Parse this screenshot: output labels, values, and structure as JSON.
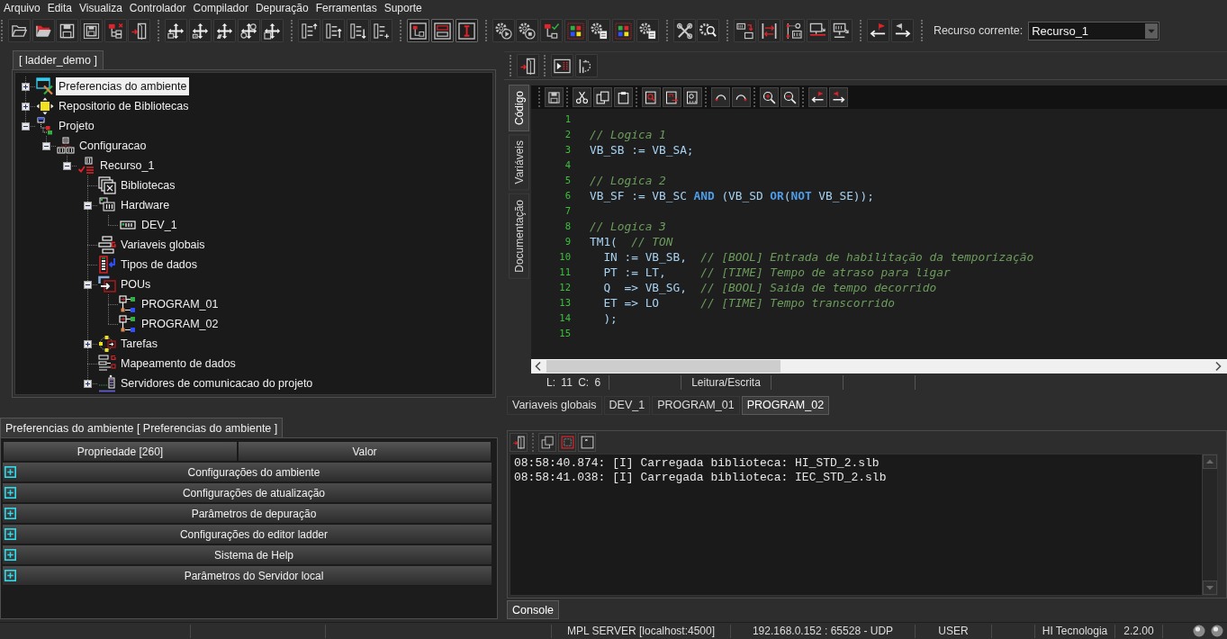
{
  "menu_bar": {
    "items": [
      "Arquivo",
      "Edita",
      "Visualiza",
      "Controlador",
      "Compilador",
      "Depuração",
      "Ferramentas",
      "Suporte"
    ]
  },
  "toolbar": {
    "resource_label": "Recurso corrente:",
    "resource_value": "Recurso_1"
  },
  "project_panel": {
    "tab": "[ ladder_demo ]",
    "tree": [
      {
        "label": "Preferencias do ambiente",
        "kind": "preferences",
        "selected": true,
        "expanded": false
      },
      {
        "label": "Repositorio de Bibliotecas",
        "kind": "library-repository",
        "selected": false,
        "expanded": false
      },
      {
        "label": "Projeto",
        "kind": "project",
        "selected": false,
        "expanded": true,
        "children": [
          {
            "label": "Configuracao",
            "kind": "configuration",
            "selected": false,
            "expanded": true,
            "children": [
              {
                "label": "Recurso_1",
                "kind": "resource",
                "selected": false,
                "expanded": true,
                "children": [
                  {
                    "label": "Bibliotecas",
                    "kind": "libraries",
                    "selected": false
                  },
                  {
                    "label": "Hardware",
                    "kind": "hardware",
                    "selected": false,
                    "expanded": true,
                    "children": [
                      {
                        "label": "DEV_1",
                        "kind": "device",
                        "selected": false
                      }
                    ]
                  },
                  {
                    "label": "Variaveis globais",
                    "kind": "global-variables",
                    "selected": false
                  },
                  {
                    "label": "Tipos de dados",
                    "kind": "data-types",
                    "selected": false
                  },
                  {
                    "label": "POUs",
                    "kind": "pous",
                    "selected": false,
                    "expanded": true,
                    "children": [
                      {
                        "label": "PROGRAM_01",
                        "kind": "program",
                        "selected": false
                      },
                      {
                        "label": "PROGRAM_02",
                        "kind": "program",
                        "selected": false
                      }
                    ]
                  },
                  {
                    "label": "Tarefas",
                    "kind": "tasks",
                    "selected": false,
                    "expanded": false
                  },
                  {
                    "label": "Mapeamento de dados",
                    "kind": "data-mapping",
                    "selected": false
                  },
                  {
                    "label": "Servidores de comunicacao do projeto",
                    "kind": "servers",
                    "selected": false,
                    "expanded": false
                  }
                ]
              }
            ]
          }
        ]
      }
    ]
  },
  "properties_panel": {
    "tab": "Preferencias do ambiente [ Preferencias do ambiente ]",
    "columns": [
      "Propriedade [260]",
      "Valor"
    ],
    "groups": [
      {
        "label": "Configurações do ambiente",
        "expanded": false
      },
      {
        "label": "Configurações de atualização",
        "expanded": false
      },
      {
        "label": "Parâmetros de depuração",
        "expanded": false
      },
      {
        "label": "Configurações do editor ladder",
        "expanded": false
      },
      {
        "label": "Sistema de Help",
        "expanded": false
      },
      {
        "label": "Parâmetros do Servidor local",
        "expanded": false
      }
    ]
  },
  "editor": {
    "side_tabs": [
      {
        "label": "Código",
        "selected": true
      },
      {
        "label": "Variáveis",
        "selected": false
      },
      {
        "label": "Documentação",
        "selected": false
      }
    ],
    "lines": [
      {
        "number": "1"
      },
      {
        "number": "2",
        "tokens": [
          {
            "kind": "comment",
            "text": "// Logica 1"
          }
        ]
      },
      {
        "number": "3",
        "tokens": [
          {
            "kind": "code",
            "text": "VB_SB := VB_SA;"
          }
        ]
      },
      {
        "number": "4"
      },
      {
        "number": "5",
        "tokens": [
          {
            "kind": "comment",
            "text": "// Logica 2"
          }
        ]
      },
      {
        "number": "6",
        "tokens": [
          {
            "kind": "code",
            "text": "VB_SF := VB_SC "
          },
          {
            "kind": "keyword",
            "text": "AND"
          },
          {
            "kind": "code",
            "text": " (VB_SD "
          },
          {
            "kind": "keyword",
            "text": "OR"
          },
          {
            "kind": "code",
            "text": "("
          },
          {
            "kind": "keyword",
            "text": "NOT"
          },
          {
            "kind": "code",
            "text": " VB_SE));"
          }
        ]
      },
      {
        "number": "7"
      },
      {
        "number": "8",
        "tokens": [
          {
            "kind": "comment",
            "text": "// Logica 3"
          }
        ]
      },
      {
        "number": "9",
        "tokens": [
          {
            "kind": "code",
            "text": "TM1(  "
          },
          {
            "kind": "comment",
            "text": "// TON"
          }
        ]
      },
      {
        "number": "10",
        "tokens": [
          {
            "kind": "code",
            "text": "  IN := VB_SB,  "
          },
          {
            "kind": "comment",
            "text": "// [BOOL] Entrada de habilitação da temporização"
          }
        ]
      },
      {
        "number": "11",
        "tokens": [
          {
            "kind": "code",
            "text": "  PT := LT,     "
          },
          {
            "kind": "comment",
            "text": "// [TIME] Tempo de atraso para ligar"
          }
        ]
      },
      {
        "number": "12",
        "tokens": [
          {
            "kind": "code",
            "text": "  Q  => VB_SG,  "
          },
          {
            "kind": "comment",
            "text": "// [BOOL] Saida de tempo decorrido"
          }
        ]
      },
      {
        "number": "13",
        "tokens": [
          {
            "kind": "code",
            "text": "  ET => LO      "
          },
          {
            "kind": "comment",
            "text": "// [TIME] Tempo transcorrido"
          }
        ]
      },
      {
        "number": "14",
        "tokens": [
          {
            "kind": "code",
            "text": "  );"
          }
        ]
      },
      {
        "number": "15"
      }
    ],
    "status": {
      "position": "L: 11 C: 6",
      "mode": "Leitura/Escrita"
    }
  },
  "document_tabs": [
    {
      "label": "Variaveis globais",
      "selected": false
    },
    {
      "label": "DEV_1",
      "selected": false
    },
    {
      "label": "PROGRAM_01",
      "selected": false
    },
    {
      "label": "PROGRAM_02",
      "selected": true
    }
  ],
  "console": {
    "lines": [
      "08:58:40.874: [I] Carregada biblioteca: HI_STD_2.slb",
      "08:58:41.038: [I] Carregada biblioteca: IEC_STD_2.slb"
    ],
    "tab": "Console"
  },
  "status_bar": {
    "items": [
      "MPL SERVER [localhost:4500]",
      "192.168.0.152 : 65528 - UDP",
      "USER",
      "HI Tecnologia",
      "2.2.00"
    ]
  }
}
